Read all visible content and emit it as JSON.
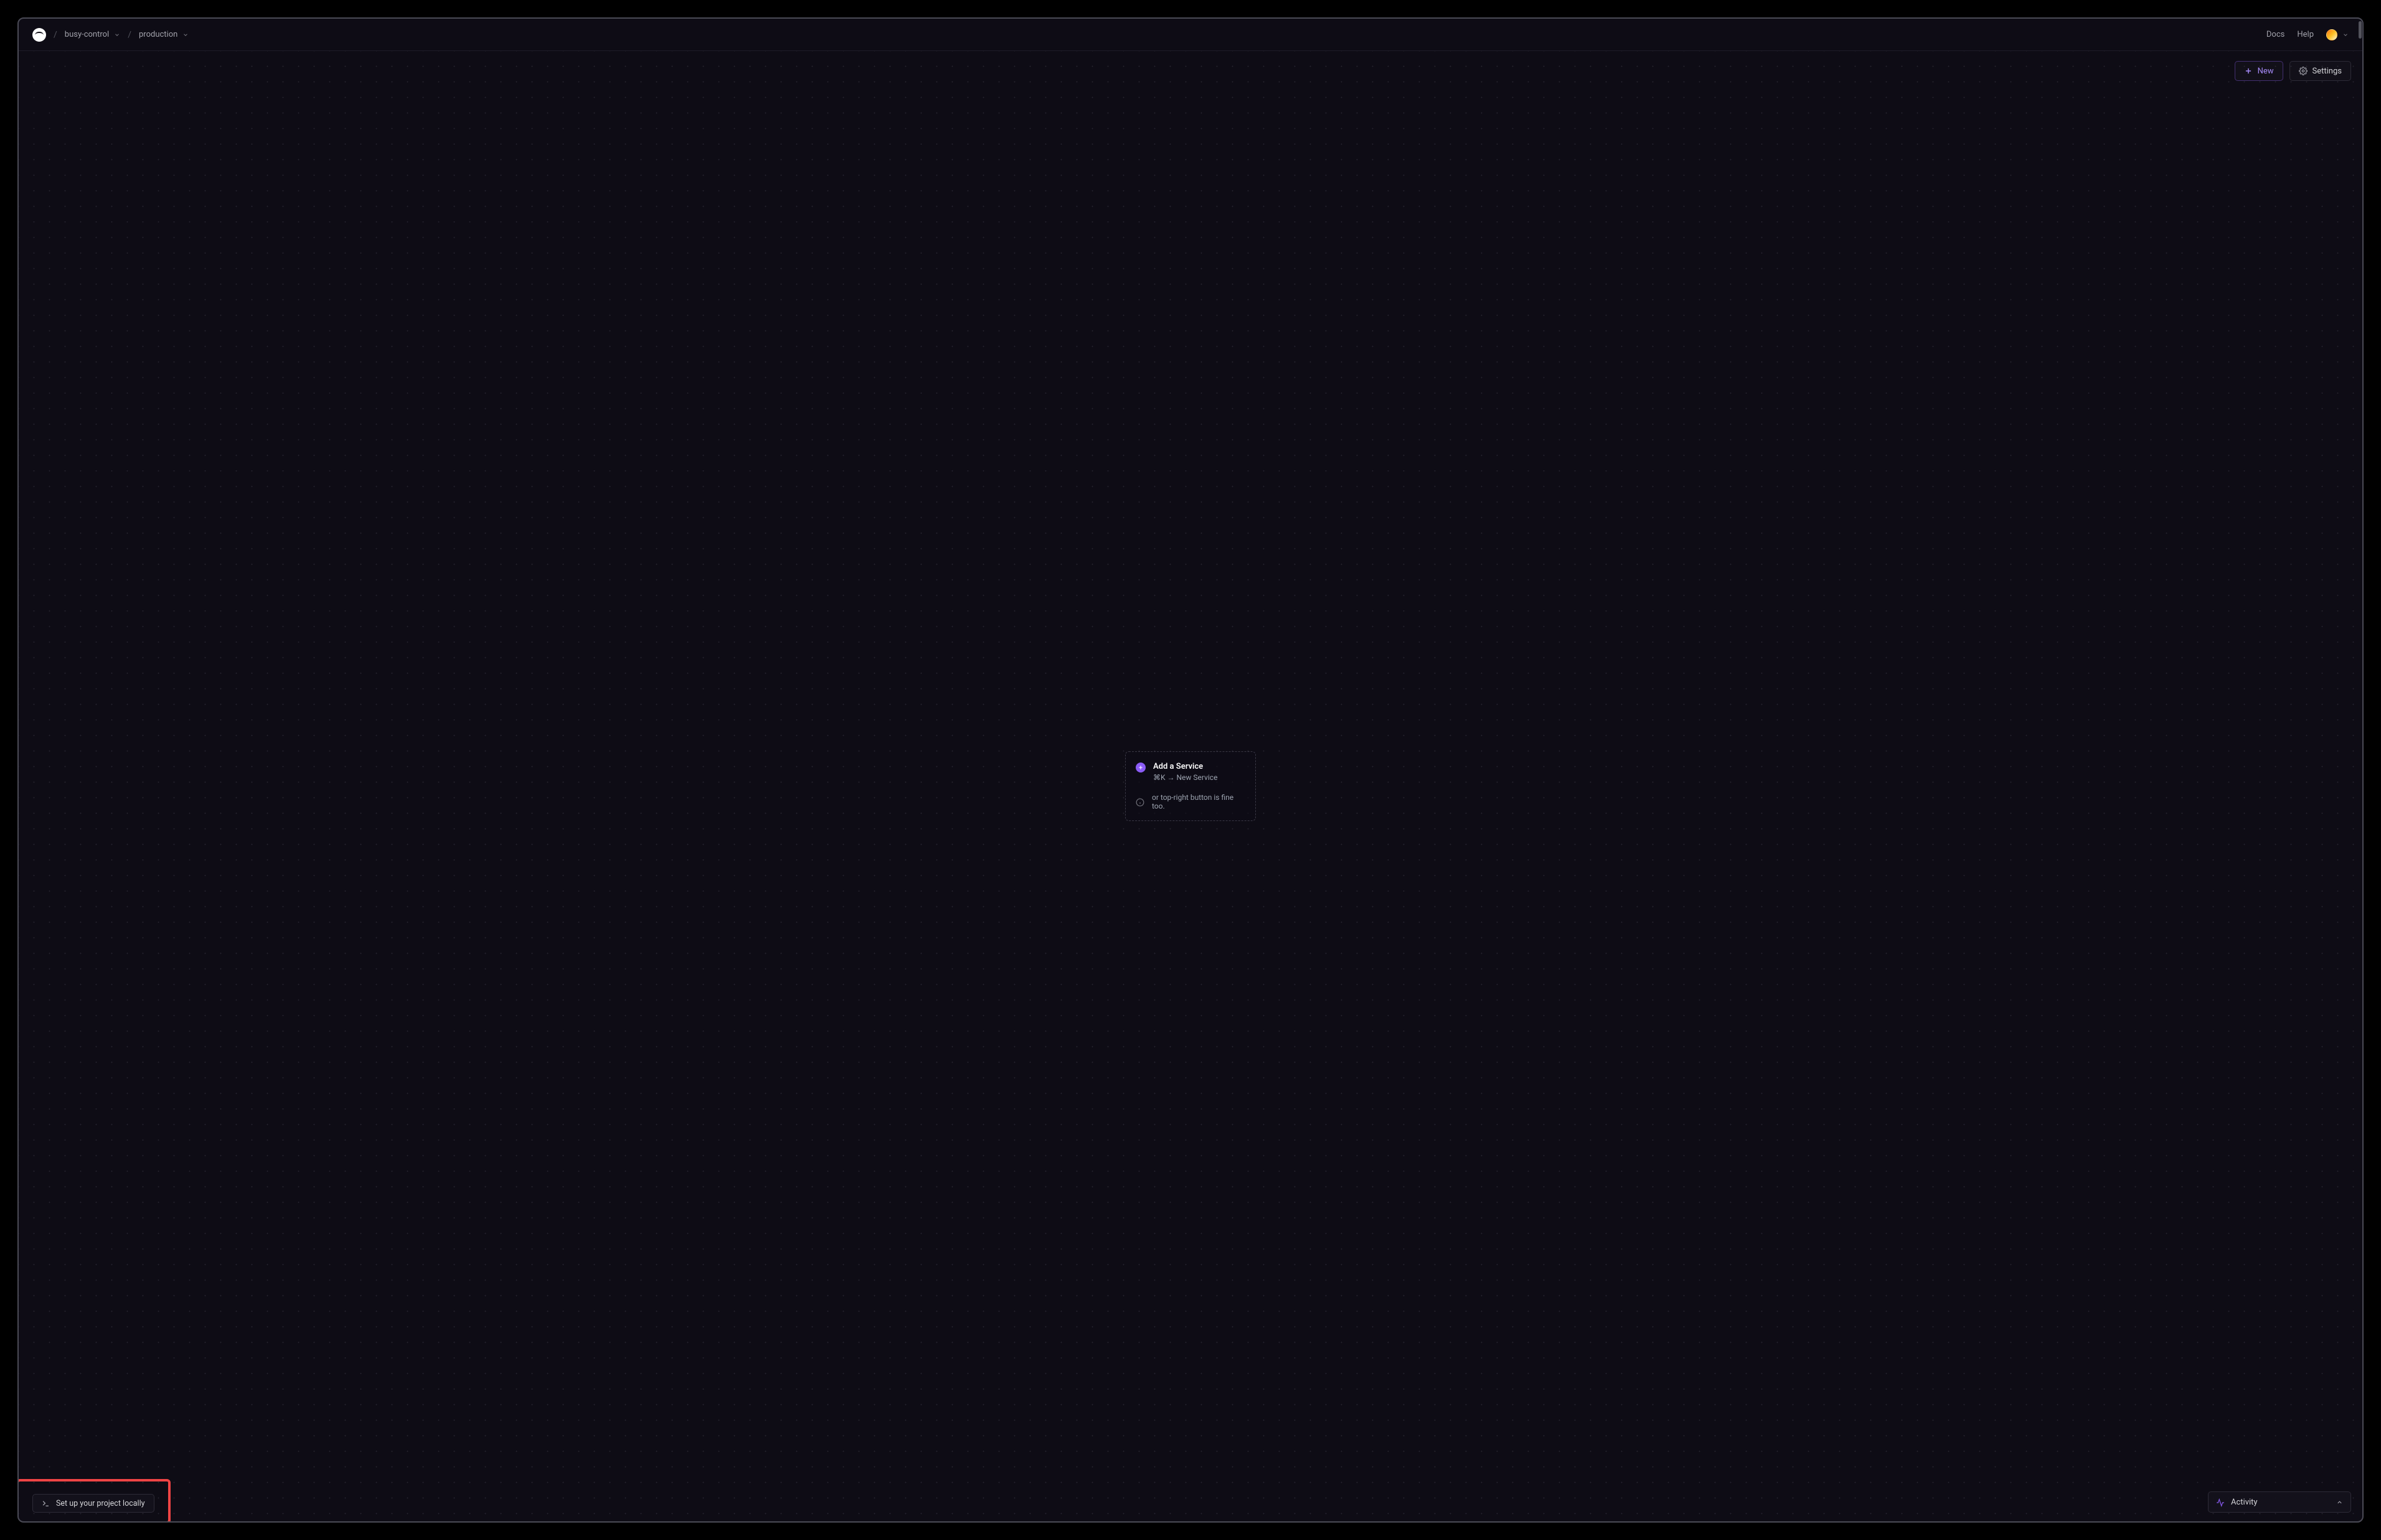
{
  "breadcrumb": {
    "project": "busy-control",
    "environment": "production"
  },
  "header": {
    "docs": "Docs",
    "help": "Help"
  },
  "actions": {
    "new_label": "New",
    "settings_label": "Settings"
  },
  "empty_card": {
    "title": "Add a Service",
    "shortcut": "⌘K → New Service",
    "hint": "or top-right button is fine too."
  },
  "bottom": {
    "setup_label": "Set up your project locally",
    "activity_label": "Activity"
  },
  "colors": {
    "accent": "#8b5cf6",
    "highlight": "#ef4444",
    "bg": "#0e0c15"
  }
}
